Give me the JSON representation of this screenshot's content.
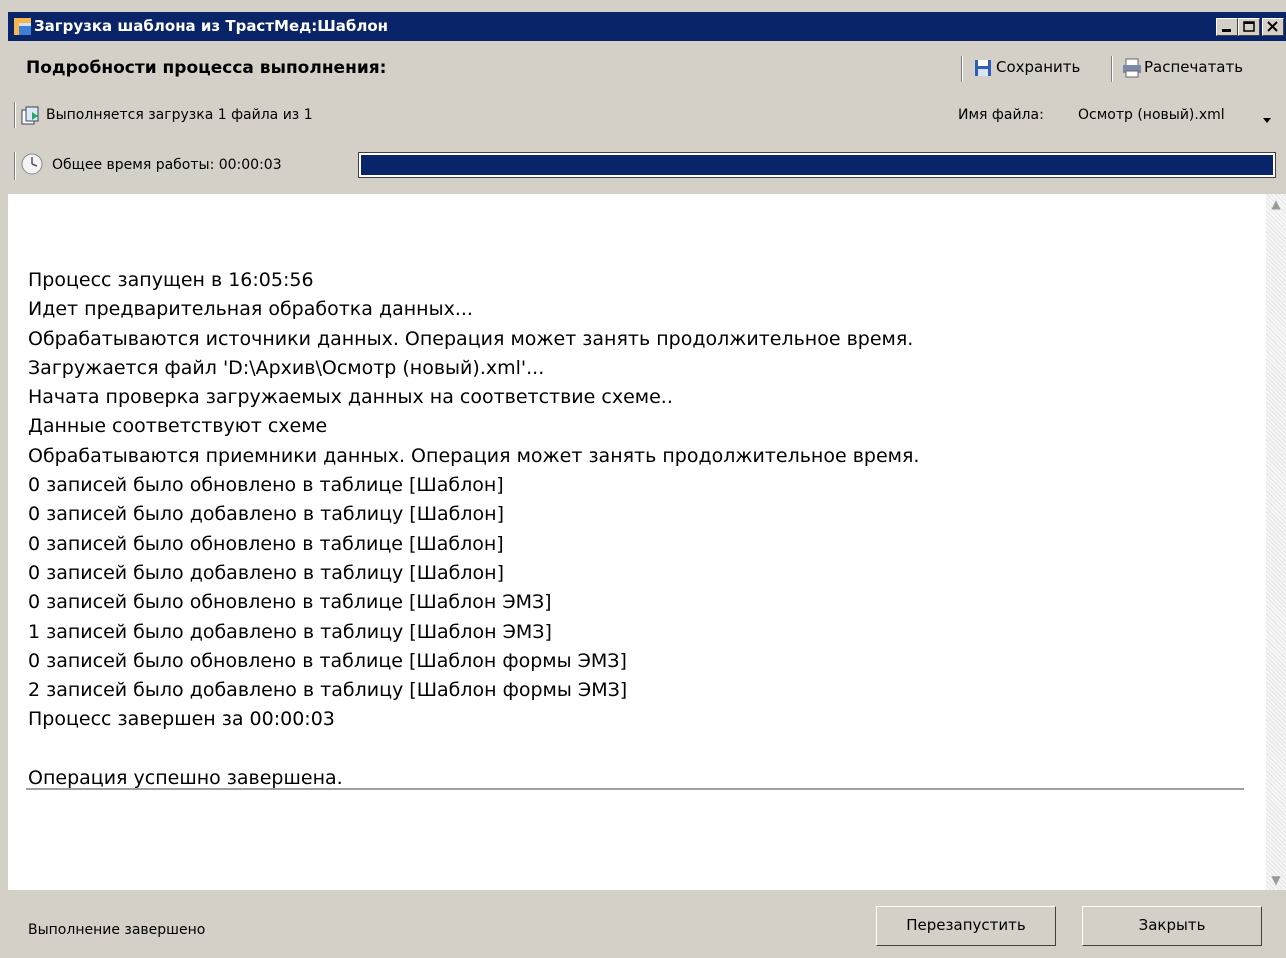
{
  "window": {
    "title": "Загрузка шаблона из ТрастМед:Шаблон",
    "title_bar_color": "#0a246a"
  },
  "header": {
    "title": "Подробности процесса выполнения:",
    "save_label": "Сохранить",
    "print_label": "Распечатать"
  },
  "progress_info": {
    "loading_text": "Выполняется загрузка 1 файла из 1",
    "file_name_label": "Имя файла:",
    "file_name_value": "Осмотр (новый).xml",
    "elapsed_text": "Общее время работы: 00:00:03",
    "progress_percent": 100
  },
  "log": {
    "lines": [
      "Процесс запущен в 16:05:56",
      "Идет предварительная обработка данных...",
      "Обрабатываются источники данных. Операция может занять продолжительное время.",
      "Загружается файл 'D:\\Архив\\Осмотр (новый).xml'...",
      "Начата проверка загружаемых данных на соответствие схеме..",
      "Данные соответствуют схеме",
      "Обрабатываются приемники данных. Операция может занять продолжительное время.",
      "0 записей было обновлено в таблице [Шаблон]",
      "0 записей было добавлено в таблицу [Шаблон]",
      "0 записей было обновлено в таблице [Шаблон]",
      "0 записей было добавлено в таблицу [Шаблон]",
      "0 записей было обновлено в таблице [Шаблон ЭМЗ]",
      "1 записей было добавлено в таблицу [Шаблон ЭМЗ]",
      "0 записей было обновлено в таблице [Шаблон формы ЭМЗ]",
      "2 записей было добавлено в таблицу [Шаблон формы ЭМЗ]",
      "Процесс завершен за 00:00:03",
      "",
      "Операция успешно завершена."
    ]
  },
  "status": {
    "text": "Выполнение завершено",
    "restart_label": "Перезапустить",
    "close_label": "Закрыть"
  }
}
